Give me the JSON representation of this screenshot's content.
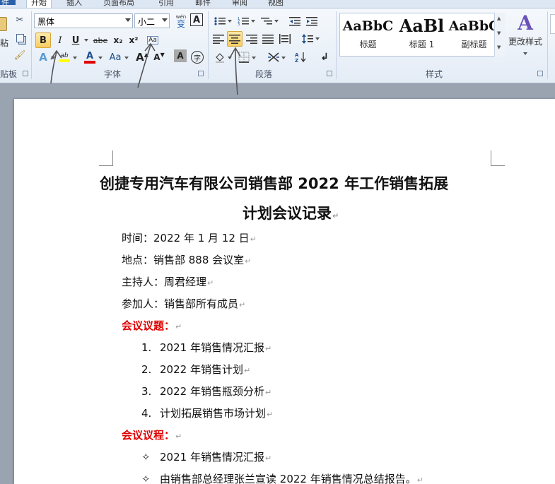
{
  "tabs": [
    {
      "label": "件"
    },
    {
      "label": "开始"
    },
    {
      "label": "插入"
    },
    {
      "label": "页面布局"
    },
    {
      "label": "引用"
    },
    {
      "label": "邮件"
    },
    {
      "label": "审阅"
    },
    {
      "label": "视图"
    }
  ],
  "clipboard": {
    "paste_label": "粘",
    "group_label": "贴板"
  },
  "font": {
    "name": "黑体",
    "size": "小二",
    "group_label": "字体",
    "wen_label": "wén",
    "wen_char": "变",
    "bold": "B",
    "italic": "I",
    "underline": "U",
    "strike": "abe",
    "subscript": "x₂",
    "superscript": "x²",
    "clear": "Aa",
    "grow": "A",
    "shrink": "A",
    "border_char": "A",
    "font_color": "A",
    "text_effects": "A",
    "highlight": "ab",
    "change_case": "Aa",
    "char_shading": "A",
    "enclose_char": "字",
    "highlight_color": "#ffff00",
    "font_color_value": "#e00000"
  },
  "paragraph": {
    "group_label": "段落"
  },
  "styles": {
    "group_label": "样式",
    "items": [
      {
        "preview": "AaBbC",
        "name": "标题"
      },
      {
        "preview": "AaBl",
        "name": "标题 1"
      },
      {
        "preview": "AaBbC",
        "name": "副标题"
      }
    ],
    "change_styles": "更改样式"
  },
  "document": {
    "title_line1": "创捷专用汽车有限公司销售部 2022 年工作销售拓展",
    "title_line2": "计划会议记录",
    "time": "时间：2022 年 1 月 12 日",
    "place": "地点：销售部 888 会议室",
    "host": "主持人：周君经理",
    "attendees": "参加人：销售部所有成员",
    "agenda_heading": "会议议题：",
    "agenda": [
      {
        "num": "1.",
        "text": "2021 年销售情况汇报"
      },
      {
        "num": "2.",
        "text": "2022 年销售计划"
      },
      {
        "num": "3.",
        "text": "2022 年销售瓶颈分析"
      },
      {
        "num": "4.",
        "text": "计划拓展销售市场计划"
      }
    ],
    "process_heading": "会议议程：",
    "process": [
      {
        "text": "2021 年销售情况汇报"
      },
      {
        "text": "由销售部总经理张兰宣读 2022 年销售情况总结报告。"
      }
    ],
    "para_mark": "↵",
    "bullet": "✧"
  }
}
